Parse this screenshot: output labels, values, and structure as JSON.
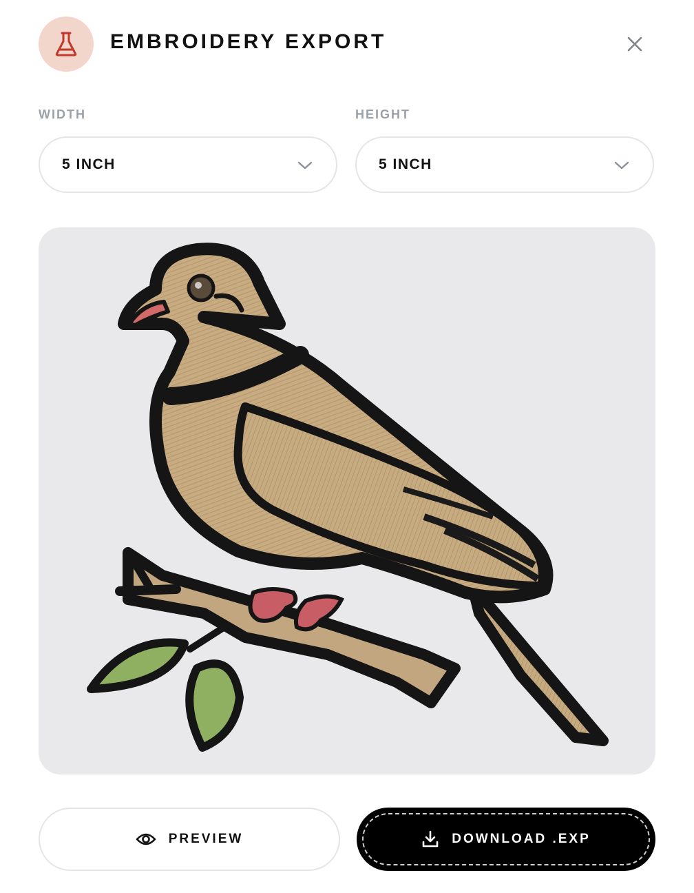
{
  "header": {
    "title": "EMBROIDERY EXPORT",
    "icon": "flask-icon",
    "close_icon": "close-icon"
  },
  "width": {
    "label": "WIDTH",
    "value": "5 INCH"
  },
  "height": {
    "label": "HEIGHT",
    "value": "5 INCH"
  },
  "preview": {
    "image": "embroidered dove on branch"
  },
  "actions": {
    "preview_label": "PREVIEW",
    "preview_icon": "eye-icon",
    "download_label": "DOWNLOAD .EXP",
    "download_icon": "download-icon"
  },
  "colors": {
    "accent": "#c0392b",
    "icon_bg": "#f2d6cc",
    "muted_label": "#9aa0a8",
    "primary_button": "#000000",
    "preview_bg": "#e9e9eb"
  }
}
